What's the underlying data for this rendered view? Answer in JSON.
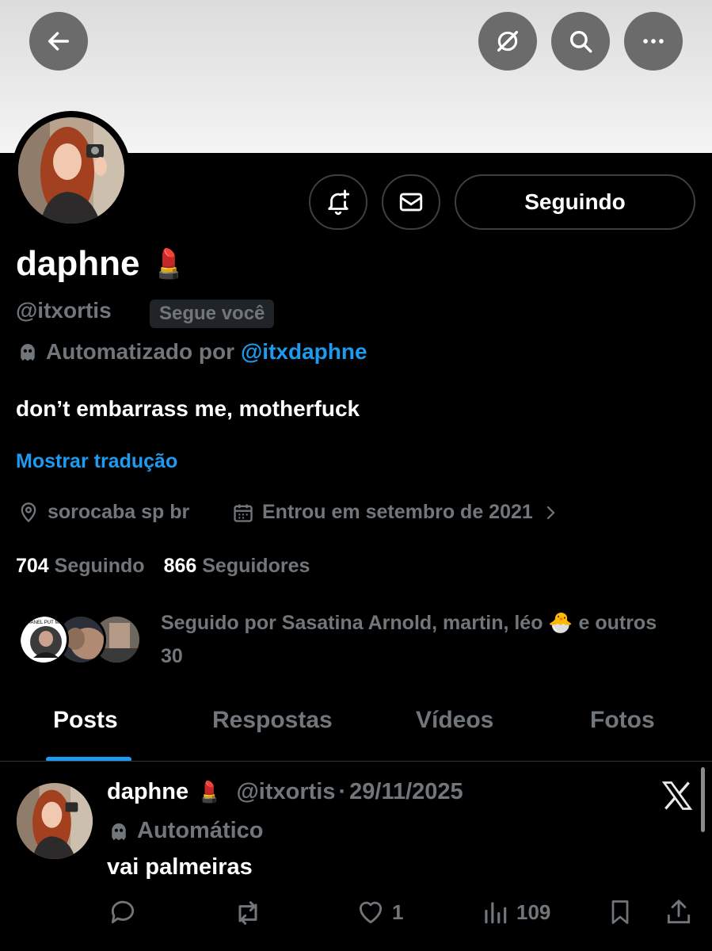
{
  "header": {
    "back_icon": "arrow-left-icon",
    "grok_icon": "grok-icon",
    "search_icon": "search-icon",
    "more_icon": "more-icon"
  },
  "profile": {
    "display_name": "daphne",
    "name_emoji": "💄",
    "handle": "@itxortis",
    "follows_you_badge": "Segue você",
    "automated_prefix": "Automatizado por",
    "automated_by": "@itxdaphne",
    "bio": "don’t embarrass me, motherfuck",
    "translate_link": "Mostrar tradução",
    "location": "sorocaba sp br",
    "joined": "Entrou em setembro de 2021",
    "following_count": "704",
    "following_label": "Seguindo",
    "followers_count": "866",
    "followers_label": "Seguidores",
    "followed_by": "Seguido por Sasatina Arnold, martin, léo 🐣 e outros 30",
    "avatar_ring_text": "CHANEL PUT ME IN"
  },
  "actions": {
    "follow_button": "Seguindo",
    "notify_icon": "bell-plus-icon",
    "message_icon": "envelope-icon"
  },
  "tabs": [
    "Posts",
    "Respostas",
    "Vídeos",
    "Fotos"
  ],
  "post": {
    "name": "daphne",
    "emoji": "💄",
    "handle": "@itxortis",
    "sep": "·",
    "date": "29/11/2025",
    "automated_label": "Automático",
    "text": "vai palmeiras",
    "likes": "1",
    "views": "109",
    "badge_icon": "x-logo-icon"
  },
  "colors": {
    "background": "#000000",
    "accent": "#1d9bf0",
    "muted_text": "#71767b",
    "text": "#e7e9ea",
    "border": "#2f3336"
  }
}
